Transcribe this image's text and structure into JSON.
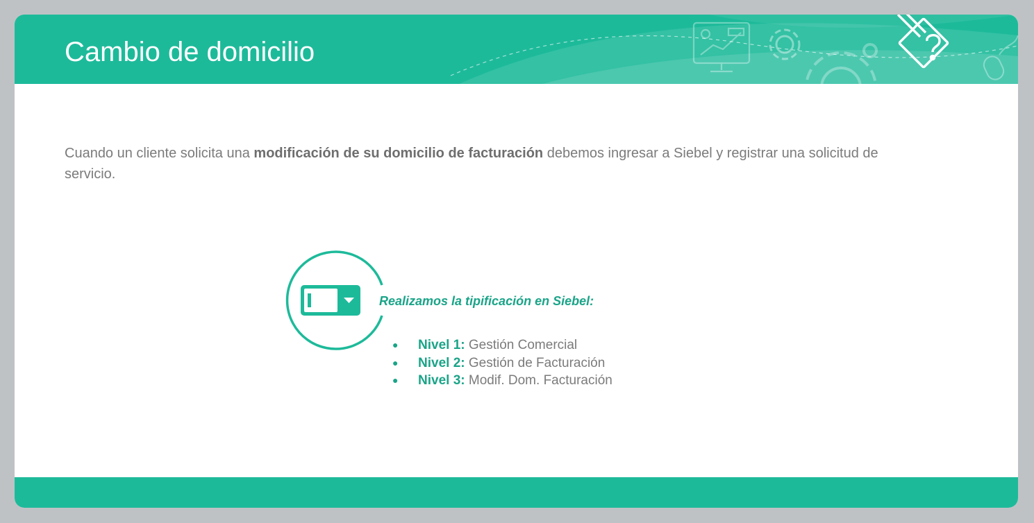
{
  "slide": {
    "title": "Cambio de domicilio",
    "intro": {
      "part1": "Cuando un cliente solicita una ",
      "bold": "modificación de su domicilio de facturación",
      "part2": " debemos ingresar a Siebel y registrar una solicitud de servicio."
    },
    "callout": "Realizamos la tipificación en Siebel:",
    "levels": [
      {
        "label": "Nivel 1:",
        "value": "Gestión Comercial"
      },
      {
        "label": "Nivel 2:",
        "value": "Gestión de Facturación"
      },
      {
        "label": "Nivel 3:",
        "value": "Modif. Dom. Facturación"
      }
    ]
  },
  "icons": {
    "badge": "dropdown-field-icon",
    "header_decor": [
      "monitor-chart-icon",
      "gear-icon",
      "large-gear-icon",
      "pencil-question-icon",
      "mouse-icon"
    ]
  },
  "colors": {
    "accent": "#1dba9a",
    "accent_text": "#1aa488",
    "body_text": "#7b7b7b",
    "frame": "#bfc2c5"
  }
}
